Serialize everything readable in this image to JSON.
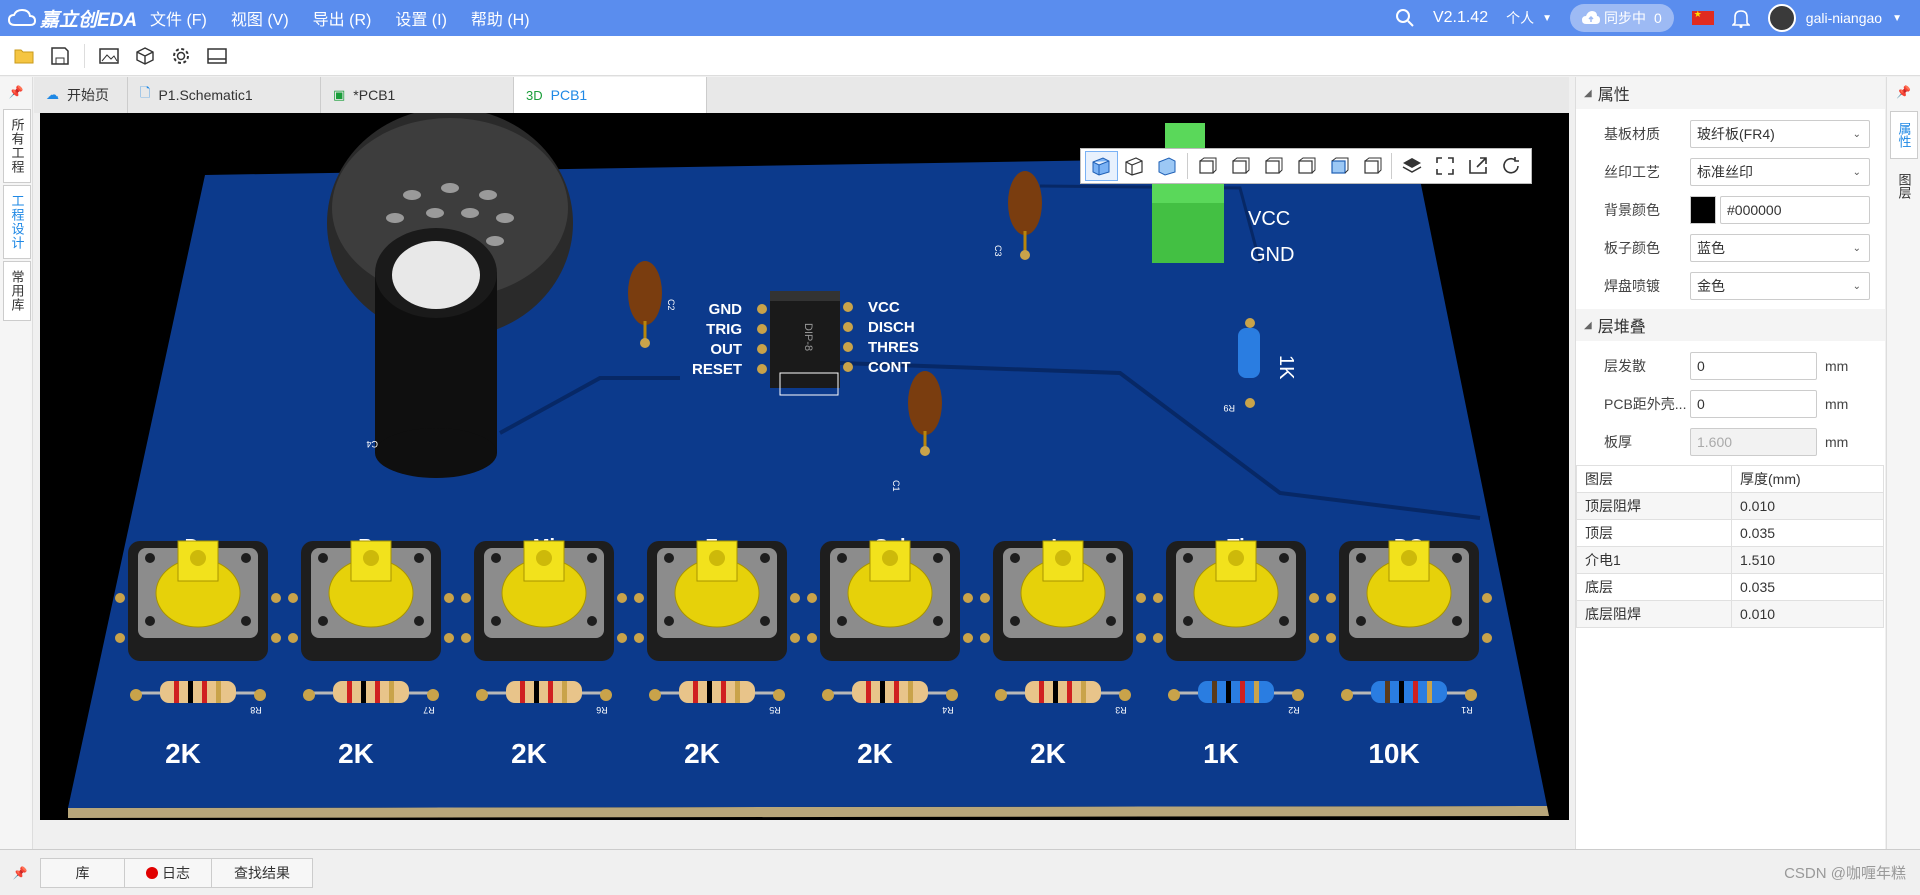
{
  "app": {
    "logo_text": "嘉立创EDA",
    "version": "V2.1.42"
  },
  "menu": [
    "文件 (F)",
    "视图 (V)",
    "导出 (R)",
    "设置 (I)",
    "帮助 (H)"
  ],
  "topright": {
    "workspace": "个人",
    "sync_label": "同步中",
    "sync_count": "0",
    "username": "gali-niangao"
  },
  "left_tabs": [
    "所有工程",
    "工程设计",
    "常用库"
  ],
  "tabs": [
    {
      "label": "开始页",
      "icon": "cloud-icon"
    },
    {
      "label": "P1.Schematic1",
      "icon": "document-icon"
    },
    {
      "label": "*PCB1",
      "icon": "pcb-icon"
    },
    {
      "label": "PCB1",
      "prefix": "3D",
      "icon": "3d-icon"
    }
  ],
  "pcb": {
    "colors": {
      "board": "#0c3a8c",
      "silk": "#ffffff",
      "background": "#000000"
    },
    "ic_pins_left": [
      "GND",
      "TRIG",
      "OUT",
      "RESET"
    ],
    "ic_pins_right": [
      "VCC",
      "DISCH",
      "THRES",
      "CONT"
    ],
    "ic_label": "DIP-8",
    "connector_labels": [
      "VCC",
      "GND"
    ],
    "r9_label": "1K",
    "keys": [
      "Do",
      "Re",
      "Mi",
      "Fa",
      "Sol",
      "La",
      "Ti",
      "DO"
    ],
    "resistor_values": [
      "2K",
      "2K",
      "2K",
      "2K",
      "2K",
      "2K",
      "1K",
      "10K"
    ],
    "resistor_refs": [
      "R8",
      "R7",
      "R6",
      "R5",
      "R4",
      "R3",
      "R2",
      "R1"
    ],
    "cap_refs": [
      "C3",
      "C2",
      "C1"
    ],
    "r9_ref": "R9",
    "speaker_ref": "C4"
  },
  "right_tabs": [
    "属性",
    "图层"
  ],
  "properties": {
    "header": "属性",
    "rows": [
      {
        "label": "基板材质",
        "value": "玻纤板(FR4)"
      },
      {
        "label": "丝印工艺",
        "value": "标准丝印"
      },
      {
        "label": "背景颜色",
        "value": "#000000"
      },
      {
        "label": "板子颜色",
        "value": "蓝色"
      },
      {
        "label": "焊盘喷镀",
        "value": "金色"
      }
    ]
  },
  "stackup": {
    "header": "层堆叠",
    "rows": [
      {
        "label": "层发散",
        "value": "0",
        "unit": "mm"
      },
      {
        "label": "PCB距外壳...",
        "value": "0",
        "unit": "mm"
      },
      {
        "label": "板厚",
        "value": "1.600",
        "unit": "mm"
      }
    ],
    "table_headers": [
      "图层",
      "厚度(mm)"
    ],
    "table": [
      [
        "顶层阻焊",
        "0.010"
      ],
      [
        "顶层",
        "0.035"
      ],
      [
        "介电1",
        "1.510"
      ],
      [
        "底层",
        "0.035"
      ],
      [
        "底层阻焊",
        "0.010"
      ]
    ]
  },
  "bottom_tabs": [
    "库",
    "日志",
    "查找结果"
  ],
  "watermark": "CSDN @咖喱年糕"
}
